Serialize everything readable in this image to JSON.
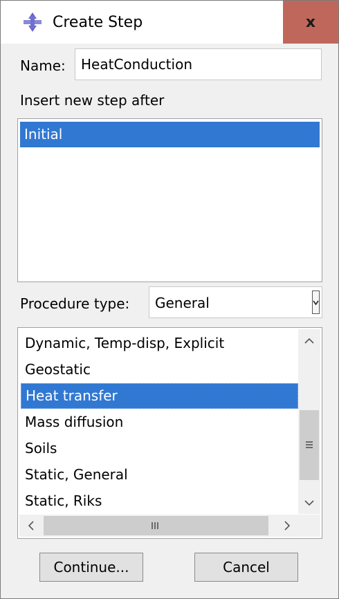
{
  "window": {
    "title": "Create Step",
    "close_label": "x"
  },
  "name_field": {
    "label": "Name:",
    "value": "HeatConduction"
  },
  "insert_after": {
    "label": "Insert new step after",
    "items": [
      "Initial"
    ],
    "selected": "Initial"
  },
  "procedure": {
    "label": "Procedure type:",
    "selected": "General",
    "list_items": [
      "Dynamic, Temp-disp, Explicit",
      "Geostatic",
      "Heat transfer",
      "Mass diffusion",
      "Soils",
      "Static, General",
      "Static, Riks"
    ],
    "selected_item": "Heat transfer"
  },
  "buttons": {
    "continue": "Continue...",
    "cancel": "Cancel"
  },
  "colors": {
    "selection": "#3178d2",
    "close_button": "#c0675c",
    "dialog_background": "#f0f0f0"
  },
  "icons": {
    "app": "abaqus-step-icon",
    "dropdown": "chevron-down-icon"
  }
}
